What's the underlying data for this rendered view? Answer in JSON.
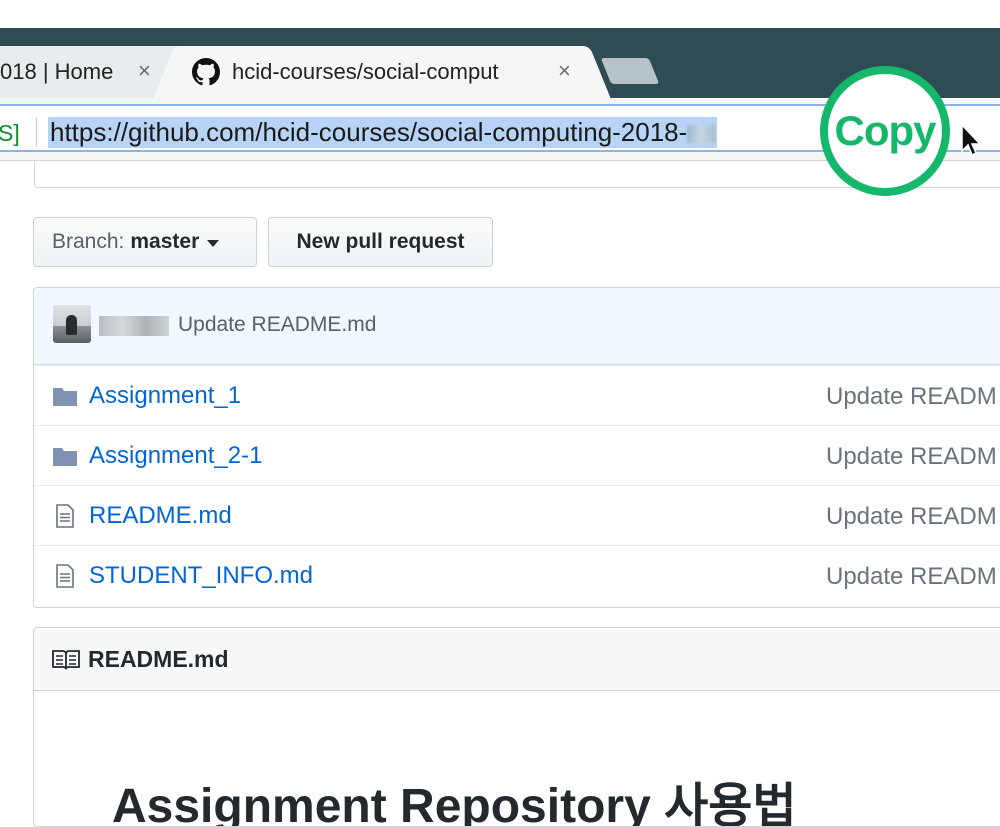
{
  "browser": {
    "tabs": [
      {
        "title": "018 | Home",
        "active": false
      },
      {
        "title": "hcid-courses/social-comput",
        "active": true
      }
    ],
    "close_glyph": "×",
    "secure_label": "S]",
    "url": "https://github.com/hcid-courses/social-computing-2018-",
    "overlay_label": "Copy",
    "overlay_color": "#15b86a"
  },
  "repo": {
    "branch_prefix": "Branch:",
    "branch_name": "master",
    "new_pr_label": "New pull request",
    "latest_commit": {
      "message": "Update README.md"
    },
    "files": [
      {
        "type": "folder",
        "icon": "folder-icon",
        "name": "Assignment_1",
        "commit": "Update READM"
      },
      {
        "type": "folder",
        "icon": "folder-icon",
        "name": "Assignment_2-1",
        "commit": "Update READM"
      },
      {
        "type": "file",
        "icon": "file-icon",
        "name": "README.md",
        "commit": "Update READM"
      },
      {
        "type": "file",
        "icon": "file-icon",
        "name": "STUDENT_INFO.md",
        "commit": "Update READM"
      }
    ]
  },
  "readme": {
    "title": "README.md",
    "heading": "Assignment Repository 사용법"
  },
  "colors": {
    "link": "#0366d6",
    "tab_strip": "#2f4c54",
    "url_selection": "#b7d3f6"
  }
}
